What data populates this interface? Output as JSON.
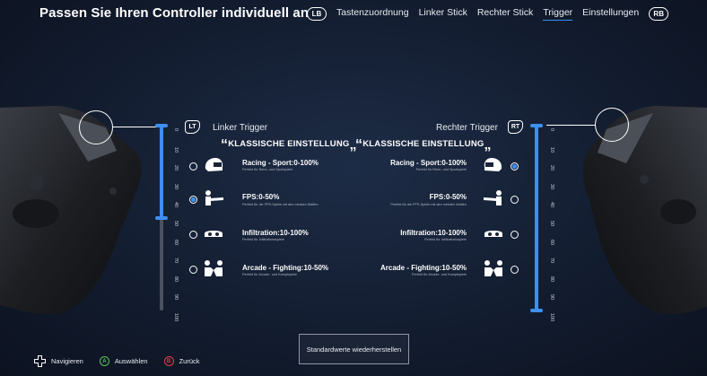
{
  "header": {
    "title": "Passen Sie Ihren Controller individuell an",
    "bumper_left": "LB",
    "bumper_right": "RB",
    "tabs": [
      {
        "label": "Tastenzuordnung",
        "active": false
      },
      {
        "label": "Linker Stick",
        "active": false
      },
      {
        "label": "Rechter Stick",
        "active": false
      },
      {
        "label": "Trigger",
        "active": true
      },
      {
        "label": "Einstellungen",
        "active": false
      }
    ]
  },
  "left_trigger": {
    "tag": "LT",
    "label": "Linker Trigger",
    "range_start_percent": 0,
    "range_end_percent": 50,
    "section_title": "KLASSISCHE EINSTELLUNG",
    "ticks": [
      "0",
      "10",
      "20",
      "30",
      "40",
      "50",
      "60",
      "70",
      "80",
      "90",
      "100"
    ],
    "options": [
      {
        "title": "Racing - Sport:0-100%",
        "subtitle": "Perfekt für Renn- und Sportspiele",
        "icon": "racing-helmet-icon",
        "selected": false
      },
      {
        "title": "FPS:0-50%",
        "subtitle": "Perfekt für die FPS-Spiele mit den meisten Waffen",
        "icon": "fps-shooter-icon",
        "selected": true
      },
      {
        "title": "Infiltration:10-100%",
        "subtitle": "Perfekt für Infiltrationsspiele",
        "icon": "infiltration-goggles-icon",
        "selected": false
      },
      {
        "title": "Arcade - Fighting:10-50%",
        "subtitle": "Perfekt für Arcade- und Kampfspiele",
        "icon": "arcade-fighting-icon",
        "selected": false
      }
    ]
  },
  "right_trigger": {
    "tag": "RT",
    "label": "Rechter Trigger",
    "range_start_percent": 0,
    "range_end_percent": 100,
    "section_title": "KLASSISCHE EINSTELLUNG",
    "ticks": [
      "0",
      "10",
      "20",
      "30",
      "40",
      "50",
      "60",
      "70",
      "80",
      "90",
      "100"
    ],
    "options": [
      {
        "title": "Racing - Sport:0-100%",
        "subtitle": "Perfekt für Renn- und Sportspiele",
        "icon": "racing-helmet-icon",
        "selected": true
      },
      {
        "title": "FPS:0-50%",
        "subtitle": "Perfekt für die FPS-Spiele mit den meisten Waffen",
        "icon": "fps-shooter-icon",
        "selected": false
      },
      {
        "title": "Infiltration:10-100%",
        "subtitle": "Perfekt für Infiltrationsspiele",
        "icon": "infiltration-goggles-icon",
        "selected": false
      },
      {
        "title": "Arcade - Fighting:10-50%",
        "subtitle": "Perfekt für Arcade- und Kampfspiele",
        "icon": "arcade-fighting-icon",
        "selected": false
      }
    ]
  },
  "reset_button": "Standardwerte wiederherstellen",
  "footer": {
    "navigate": "Navigieren",
    "select_key": "A",
    "select": "Auswählen",
    "back_key": "B",
    "back": "Zurück"
  },
  "colors": {
    "accent": "#3d8ff0",
    "track_inactive": "#4a5160",
    "a_button": "#5cc15c",
    "b_button": "#e0404a"
  }
}
